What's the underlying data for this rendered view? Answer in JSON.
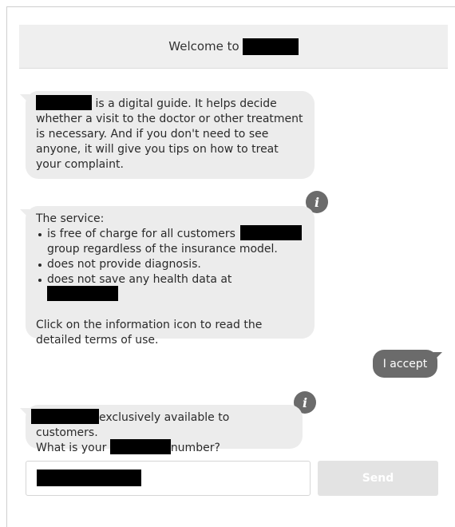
{
  "header": {
    "welcome_text": "Welcome to"
  },
  "messages": {
    "intro": {
      "line1_tail": "is a digital guide. It helps decide",
      "line2": "whether a visit to the doctor or other treatment",
      "line3": "is necessary. And if you don't need to see",
      "line4": "anyone, it will give you tips on how to treat",
      "line5": "your complaint."
    },
    "service": {
      "heading": "The service:",
      "bullet1_line1": "is free of charge for all customers",
      "bullet1_line2": "group regardless of the insurance model.",
      "bullet2": "does not provide diagnosis.",
      "bullet3": "does not save any health data at",
      "footer_line1": "Click on the information icon to read the",
      "footer_line2": "detailed terms of use."
    },
    "user_reply": "I accept",
    "prompt": {
      "line1_tail": "exclusively available to customers.",
      "line2_head": "What is your",
      "line2_tail": "number?"
    }
  },
  "icons": {
    "info": "i"
  },
  "composer": {
    "send_label": "Send"
  },
  "colors": {
    "bot_bubble": "#ececec",
    "user_bubble": "#6b6b6b",
    "header_bg": "#efefef",
    "send_disabled": "#e3e3e3"
  }
}
